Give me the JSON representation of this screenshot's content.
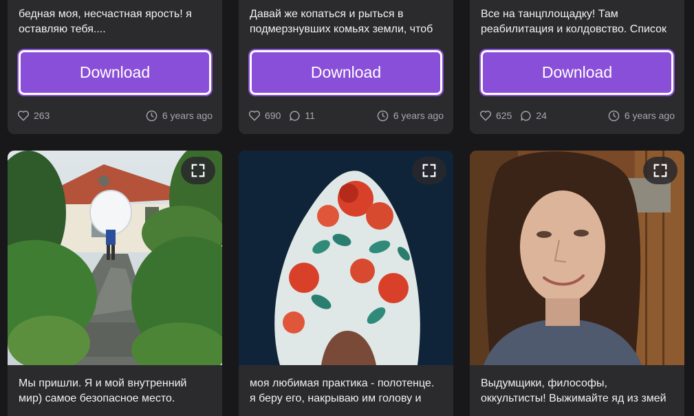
{
  "top_cards": [
    {
      "caption": "бедная моя, несчастная ярость! я\nоставляю тебя....",
      "download_label": "Download",
      "likes": "263",
      "comments": "",
      "time": "6 years ago"
    },
    {
      "caption": "Давай же копаться и рыться в\nподмерзнувших комьях земли, чтоб",
      "download_label": "Download",
      "likes": "690",
      "comments": "11",
      "time": "6 years ago"
    },
    {
      "caption": "Все на танцплощадку! Там\nреабилитация и колдовство. Список",
      "download_label": "Download",
      "likes": "625",
      "comments": "24",
      "time": "6 years ago"
    }
  ],
  "bottom_cards": [
    {
      "caption": "Мы пришли. Я и мой внутренний\nмир) самое безопасное место."
    },
    {
      "caption": "моя любимая практика - полотенце.\nя беру его, накрываю им голову и"
    },
    {
      "caption": "Выдумщики, философы,\nоккультисты! Выжимайте яд из змей"
    }
  ],
  "icons": {
    "likes": "heart-icon",
    "comments": "comment-icon",
    "time": "clock-icon",
    "expand": "expand-icon"
  },
  "colors": {
    "background": "#18181b",
    "card": "#2b2b2e",
    "accent": "#8a4fd8",
    "muted_text": "#a8a8ad"
  }
}
